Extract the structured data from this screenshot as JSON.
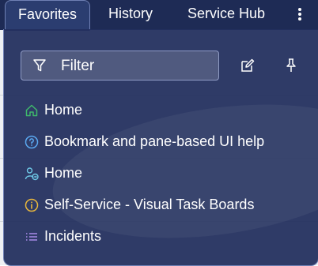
{
  "nav": {
    "tabs": [
      {
        "label": "Favorites",
        "active": true
      },
      {
        "label": "History",
        "active": false
      },
      {
        "label": "Service Hub",
        "active": false
      }
    ],
    "more_icon": "vertical-ellipsis-icon"
  },
  "panel": {
    "filter": {
      "placeholder": "Filter",
      "icon": "filter-funnel-icon"
    },
    "actions": [
      {
        "icon": "edit-pencil-icon"
      },
      {
        "icon": "pin-icon"
      }
    ],
    "items": [
      {
        "label": "Home",
        "icon": "home-icon",
        "icon_color": "#3fb86b"
      },
      {
        "label": "Bookmark and pane-based UI help",
        "icon": "help-circle-icon",
        "icon_color": "#5aa8f0"
      },
      {
        "label": "Home",
        "icon": "user-link-icon",
        "icon_color": "#6ec8e6"
      },
      {
        "label": "Self-Service - Visual Task Boards",
        "icon": "info-circle-icon",
        "icon_color": "#e9b73c"
      },
      {
        "label": "Incidents",
        "icon": "list-icon",
        "icon_color": "#a98be8"
      }
    ]
  },
  "colors": {
    "topbar": "#1e2b55",
    "panel": "#232f5e",
    "text": "#ffffff"
  }
}
